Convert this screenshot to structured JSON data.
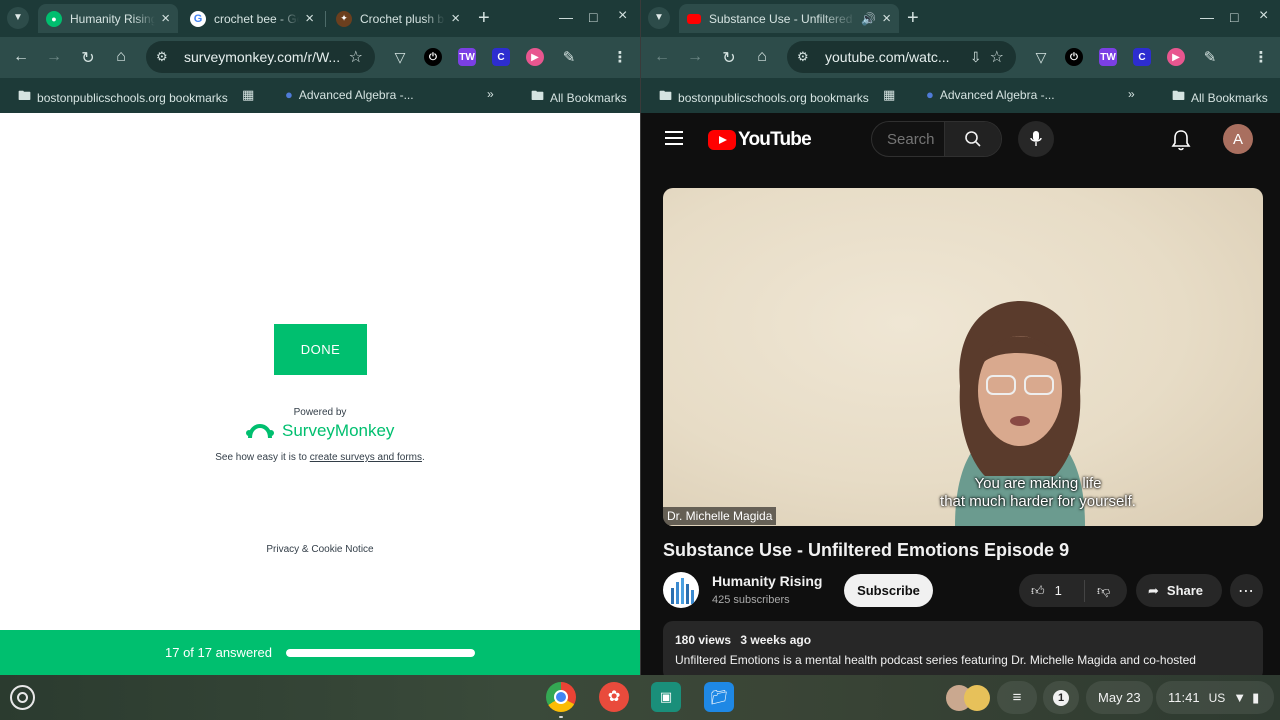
{
  "left_window": {
    "tabs": [
      {
        "title": "Humanity Rising",
        "active": true
      },
      {
        "title": "crochet bee - Google Search",
        "active": false
      },
      {
        "title": "Crochet plush bee",
        "active": false
      }
    ],
    "url": "surveymonkey.com/r/W...",
    "bookmarks": {
      "folder1": "bostonpublicschools.org bookmarks",
      "item1": "Advanced Algebra -...",
      "all": "All Bookmarks"
    },
    "survey": {
      "done_label": "DONE",
      "powered_by": "Powered by",
      "brand": "SurveyMonkey",
      "see_how_prefix": "See how easy it is to ",
      "see_how_link": "create surveys and forms",
      "see_how_suffix": ".",
      "privacy": "Privacy & Cookie Notice",
      "progress_text": "17 of 17 answered",
      "progress_fraction": 1.0
    }
  },
  "right_window": {
    "tabs": [
      {
        "title": "Substance Use - Unfiltered Emotions",
        "active": true
      }
    ],
    "url": "youtube.com/watc...",
    "bookmarks": {
      "folder1": "bostonpublicschools.org bookmarks",
      "item1": "Advanced Algebra -...",
      "all": "All Bookmarks"
    },
    "youtube": {
      "logo_text": "YouTube",
      "search_placeholder": "Search",
      "avatar_letter": "A",
      "subtitle_line1": "You are making life",
      "subtitle_line2": "that much harder for yourself.",
      "speaker_tag": "Dr. Michelle Magida",
      "video_title": "Substance Use - Unfiltered Emotions Episode 9",
      "channel_name": "Humanity Rising",
      "subscribers": "425 subscribers",
      "subscribe_label": "Subscribe",
      "like_count": "1",
      "share_label": "Share",
      "views": "180 views",
      "uploaded": "3 weeks ago",
      "description": "Unfiltered Emotions is a mental health podcast series featuring Dr. Michelle Magida and co-hosted"
    }
  },
  "shelf": {
    "date": "May 23",
    "time": "11:41",
    "locale": "US",
    "notification_count": "1"
  },
  "colors": {
    "chrome_frame": "#1d3a38",
    "chrome_toolbar": "#2d4c4a",
    "surveymonkey_green": "#00bf6f",
    "youtube_red": "#ff0000",
    "youtube_bg": "#0f0f0f"
  }
}
